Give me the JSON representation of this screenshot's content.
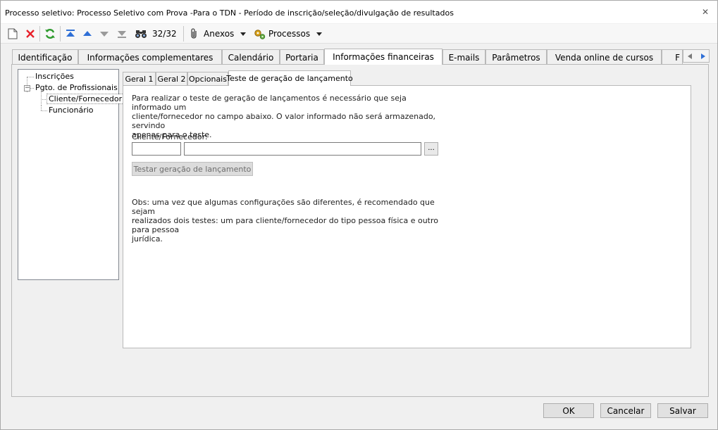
{
  "window": {
    "title": "Processo seletivo: Processo Seletivo com Prova -Para o TDN - Período de inscrição/seleção/divulgação de resultados"
  },
  "toolbar": {
    "record_counter": "32/32",
    "anexos_label": "Anexos",
    "processos_label": "Processos"
  },
  "tabs": [
    {
      "label": "Identificação"
    },
    {
      "label": "Informações complementares"
    },
    {
      "label": "Calendário"
    },
    {
      "label": "Portaria"
    },
    {
      "label": "Informações financeiras"
    },
    {
      "label": "E-mails"
    },
    {
      "label": "Parâmetros"
    },
    {
      "label": "Venda online de cursos"
    },
    {
      "label": "F"
    }
  ],
  "tree": {
    "items": [
      {
        "label": "Inscrições"
      },
      {
        "label": "Pgto. de Profissionais"
      },
      {
        "label": "Cliente/Fornecedor"
      },
      {
        "label": "Funcionário"
      }
    ]
  },
  "subtabs": [
    {
      "label": "Geral 1"
    },
    {
      "label": "Geral 2"
    },
    {
      "label": "Opcionais"
    },
    {
      "label": "Teste de geração de lançamento"
    }
  ],
  "panel": {
    "intro_lines": [
      "Para realizar o teste de geração de lançamentos é necessário que seja informado um",
      "cliente/fornecedor no campo abaixo. O valor informado não será armazenado, servindo",
      "apenas para o teste."
    ],
    "field_label": "Cliente/Fornecedor:",
    "code_value": "",
    "name_value": "",
    "lookup_label": "...",
    "test_button_label": "Testar geração de lançamento",
    "obs_lines": [
      "Obs: uma vez que algumas configurações são diferentes, é recomendado que sejam",
      "realizados dois testes: um para cliente/fornecedor do tipo pessoa física e outro para pessoa",
      "jurídica."
    ]
  },
  "footer": {
    "ok_label": "OK",
    "cancel_label": "Cancelar",
    "save_label": "Salvar"
  },
  "colors": {
    "delete_red": "#e8202a",
    "refresh_green": "#2e9a2e",
    "nav_blue": "#2f6fd6"
  }
}
